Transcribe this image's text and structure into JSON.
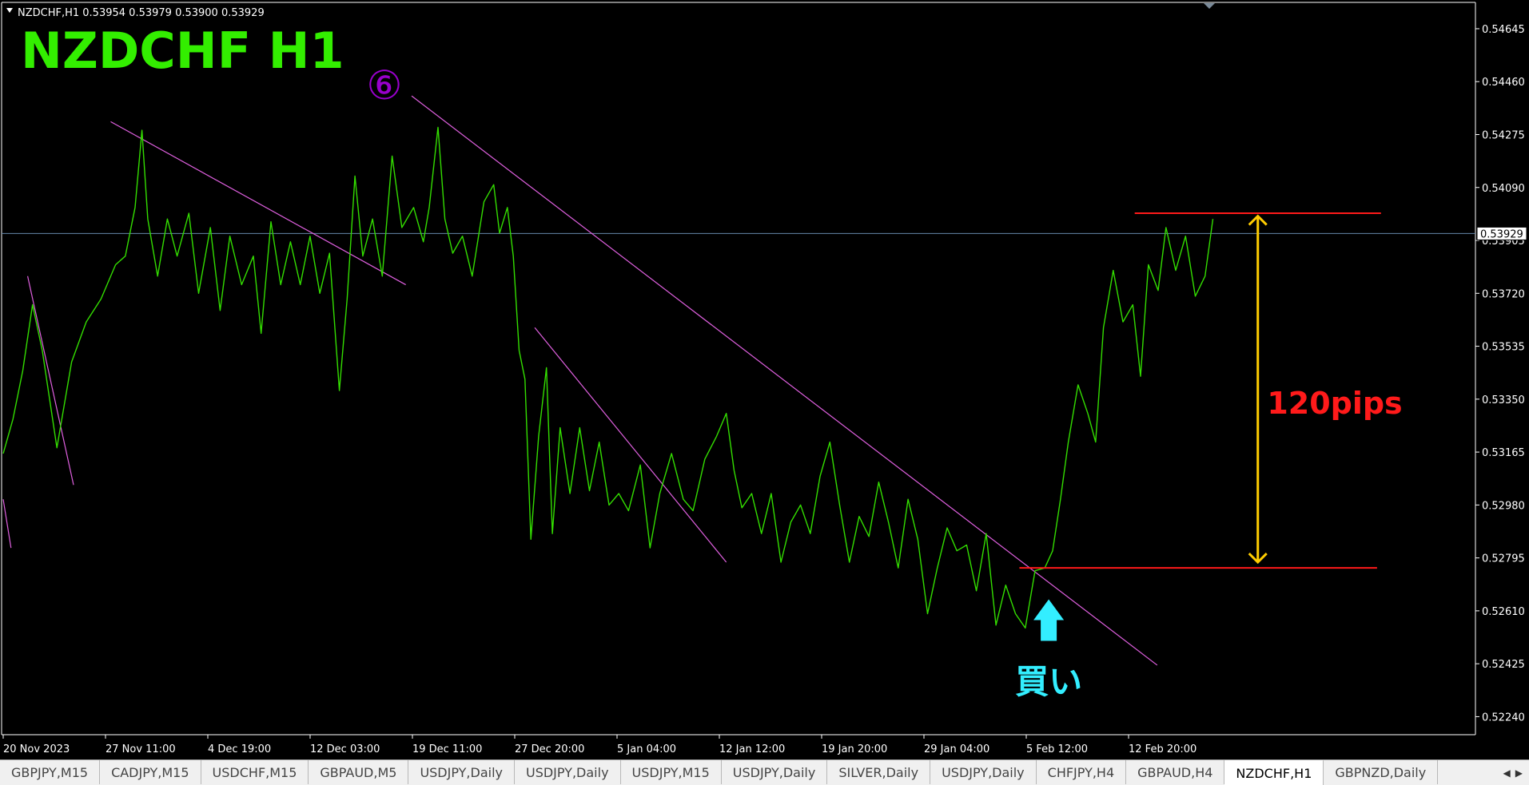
{
  "header": {
    "info_text": "NZDCHF,H1  0.53954 0.53979 0.53900 0.53929",
    "title": "NZDCHF  H1",
    "marker": "⑥"
  },
  "annotations": {
    "range_label": "120pips",
    "buy_label": "買い",
    "buy_arrow_icon": "up-arrow-icon"
  },
  "colors": {
    "background": "#000000",
    "price_line": "#33dd00",
    "title": "#33ee00",
    "trendline": "#e060e0",
    "level_line": "#ff1a1a",
    "range_arrow": "#ffcc00",
    "range_label": "#ff1a1a",
    "buy_arrow": "#33eeff",
    "marker": "#9900cc"
  },
  "chart_data": {
    "type": "line",
    "symbol": "NZDCHF",
    "timeframe": "H1",
    "ohlc": {
      "open": 0.53954,
      "high": 0.53979,
      "low": 0.539,
      "close": 0.53929
    },
    "current_price": "0.53929",
    "ylim": [
      0.52177,
      0.54737
    ],
    "y_ticks": [
      "0.54645",
      "0.54460",
      "0.54275",
      "0.54090",
      "0.53905",
      "0.53720",
      "0.53535",
      "0.53350",
      "0.53165",
      "0.52980",
      "0.52795",
      "0.52610",
      "0.52425",
      "0.52240"
    ],
    "x_ticks": [
      "20 Nov 2023",
      "27 Nov 11:00",
      "4 Dec 19:00",
      "12 Dec 03:00",
      "19 Dec 11:00",
      "27 Dec 20:00",
      "5 Jan 04:00",
      "12 Jan 12:00",
      "19 Jan 20:00",
      "29 Jan 04:00",
      "5 Feb 12:00",
      "12 Feb 20:00"
    ],
    "bar_index_range": [
      0,
      1420
    ],
    "series": [
      {
        "points": [
          [
            0,
            0.5316
          ],
          [
            10,
            0.5328
          ],
          [
            20,
            0.5345
          ],
          [
            30,
            0.5368
          ],
          [
            40,
            0.5352
          ],
          [
            55,
            0.5318
          ],
          [
            70,
            0.5348
          ],
          [
            85,
            0.5362
          ],
          [
            100,
            0.537
          ],
          [
            115,
            0.5382
          ],
          [
            125,
            0.5385
          ],
          [
            135,
            0.5402
          ],
          [
            142,
            0.5429
          ],
          [
            148,
            0.5398
          ],
          [
            158,
            0.5378
          ],
          [
            168,
            0.5398
          ],
          [
            178,
            0.5385
          ],
          [
            190,
            0.54
          ],
          [
            200,
            0.5372
          ],
          [
            212,
            0.5395
          ],
          [
            222,
            0.5366
          ],
          [
            232,
            0.5392
          ],
          [
            244,
            0.5375
          ],
          [
            256,
            0.5385
          ],
          [
            264,
            0.5358
          ],
          [
            274,
            0.5397
          ],
          [
            284,
            0.5375
          ],
          [
            294,
            0.539
          ],
          [
            304,
            0.5375
          ],
          [
            314,
            0.5392
          ],
          [
            324,
            0.5372
          ],
          [
            334,
            0.5386
          ],
          [
            344,
            0.5338
          ],
          [
            352,
            0.537
          ],
          [
            360,
            0.5413
          ],
          [
            368,
            0.5385
          ],
          [
            378,
            0.5398
          ],
          [
            388,
            0.5378
          ],
          [
            398,
            0.542
          ],
          [
            408,
            0.5395
          ],
          [
            420,
            0.5402
          ],
          [
            430,
            0.539
          ],
          [
            436,
            0.5402
          ],
          [
            445,
            0.543
          ],
          [
            452,
            0.5398
          ],
          [
            460,
            0.5386
          ],
          [
            470,
            0.5392
          ],
          [
            480,
            0.5378
          ],
          [
            492,
            0.5404
          ],
          [
            502,
            0.541
          ],
          [
            508,
            0.5393
          ],
          [
            516,
            0.5402
          ],
          [
            522,
            0.5385
          ],
          [
            528,
            0.5352
          ],
          [
            534,
            0.5342
          ],
          [
            540,
            0.5286
          ],
          [
            548,
            0.5322
          ],
          [
            556,
            0.5346
          ],
          [
            562,
            0.5288
          ],
          [
            570,
            0.5325
          ],
          [
            580,
            0.5302
          ],
          [
            590,
            0.5325
          ],
          [
            600,
            0.5303
          ],
          [
            610,
            0.532
          ],
          [
            620,
            0.5298
          ],
          [
            630,
            0.5302
          ],
          [
            640,
            0.5296
          ],
          [
            652,
            0.5312
          ],
          [
            662,
            0.5283
          ],
          [
            672,
            0.5302
          ],
          [
            684,
            0.5316
          ],
          [
            696,
            0.53
          ],
          [
            706,
            0.5296
          ],
          [
            718,
            0.5314
          ],
          [
            730,
            0.5322
          ],
          [
            740,
            0.533
          ],
          [
            748,
            0.531
          ],
          [
            756,
            0.5297
          ],
          [
            766,
            0.5302
          ],
          [
            776,
            0.5288
          ],
          [
            786,
            0.5302
          ],
          [
            796,
            0.5278
          ],
          [
            806,
            0.5292
          ],
          [
            816,
            0.5298
          ],
          [
            826,
            0.5288
          ],
          [
            836,
            0.5308
          ],
          [
            846,
            0.532
          ],
          [
            856,
            0.5298
          ],
          [
            866,
            0.5278
          ],
          [
            876,
            0.5294
          ],
          [
            886,
            0.5287
          ],
          [
            896,
            0.5306
          ],
          [
            906,
            0.5292
          ],
          [
            916,
            0.5276
          ],
          [
            926,
            0.53
          ],
          [
            936,
            0.5286
          ],
          [
            946,
            0.526
          ],
          [
            956,
            0.5276
          ],
          [
            966,
            0.529
          ],
          [
            976,
            0.5282
          ],
          [
            986,
            0.5284
          ],
          [
            996,
            0.5268
          ],
          [
            1006,
            0.5288
          ],
          [
            1016,
            0.5256
          ],
          [
            1026,
            0.527
          ],
          [
            1036,
            0.526
          ],
          [
            1046,
            0.5255
          ],
          [
            1056,
            0.5275
          ],
          [
            1066,
            0.5276
          ],
          [
            1074,
            0.5282
          ],
          [
            1082,
            0.53
          ],
          [
            1090,
            0.532
          ],
          [
            1100,
            0.534
          ],
          [
            1110,
            0.533
          ],
          [
            1118,
            0.532
          ],
          [
            1126,
            0.536
          ],
          [
            1136,
            0.538
          ],
          [
            1146,
            0.5362
          ],
          [
            1156,
            0.5368
          ],
          [
            1164,
            0.5343
          ],
          [
            1172,
            0.5382
          ],
          [
            1182,
            0.5373
          ],
          [
            1190,
            0.5395
          ],
          [
            1200,
            0.538
          ],
          [
            1210,
            0.5392
          ],
          [
            1220,
            0.5371
          ],
          [
            1230,
            0.5378
          ],
          [
            1238,
            0.5398
          ]
        ]
      }
    ],
    "trendlines": [
      {
        "from": [
          25,
          0.5378
        ],
        "to": [
          72,
          0.5305
        ]
      },
      {
        "from": [
          0,
          0.53
        ],
        "to": [
          8,
          0.5283
        ]
      },
      {
        "from": [
          110,
          0.5432
        ],
        "to": [
          412,
          0.5375
        ]
      },
      {
        "from": [
          418,
          0.5441
        ],
        "to": [
          1181,
          0.5242
        ]
      },
      {
        "from": [
          544,
          0.536
        ],
        "to": [
          740,
          0.5278
        ]
      }
    ],
    "levels": [
      {
        "price": 0.54,
        "from": 1158,
        "to": 1410
      },
      {
        "price": 0.5276,
        "from": 1040,
        "to": 1406
      }
    ],
    "range_arrow": {
      "bar": 1284,
      "from_price": 0.5278,
      "to_price": 0.5399
    },
    "buy_signal": {
      "bar": 1070,
      "price": 0.526
    }
  },
  "tabs": [
    {
      "label": "GBPJPY,M15",
      "active": false
    },
    {
      "label": "CADJPY,M15",
      "active": false
    },
    {
      "label": "USDCHF,M15",
      "active": false
    },
    {
      "label": "GBPAUD,M5",
      "active": false
    },
    {
      "label": "USDJPY,Daily",
      "active": false
    },
    {
      "label": "USDJPY,Daily",
      "active": false
    },
    {
      "label": "USDJPY,M15",
      "active": false
    },
    {
      "label": "USDJPY,Daily",
      "active": false
    },
    {
      "label": "SILVER,Daily",
      "active": false
    },
    {
      "label": "USDJPY,Daily",
      "active": false
    },
    {
      "label": "CHFJPY,H4",
      "active": false
    },
    {
      "label": "GBPAUD,H4",
      "active": false
    },
    {
      "label": "NZDCHF,H1",
      "active": true
    },
    {
      "label": "GBPNZD,Daily",
      "active": false
    }
  ]
}
